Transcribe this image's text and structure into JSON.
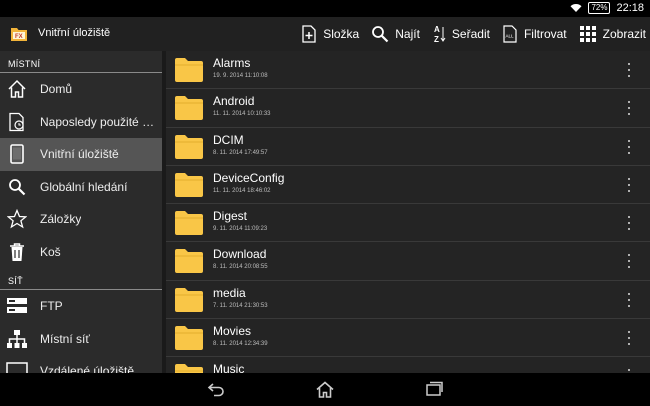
{
  "status": {
    "battery": "72%",
    "time": "22:18"
  },
  "app": {
    "title": "Vnitřní úložiště"
  },
  "actions": [
    {
      "label": "Složka",
      "icon": "new-folder-icon"
    },
    {
      "label": "Najít",
      "icon": "search-icon"
    },
    {
      "label": "Seřadit",
      "icon": "sort-az-icon"
    },
    {
      "label": "Filtrovat",
      "icon": "filter-icon"
    },
    {
      "label": "Zobrazit",
      "icon": "grid-view-icon"
    }
  ],
  "sidebar": {
    "sections": [
      {
        "header": "MÍSTNÍ",
        "items": [
          {
            "label": "Domů",
            "icon": "home-icon"
          },
          {
            "label": "Naposledy použité soubory",
            "icon": "recent-icon"
          },
          {
            "label": "Vnitřní úložiště",
            "icon": "tablet-icon",
            "active": true
          },
          {
            "label": "Globální hledání",
            "icon": "search-icon"
          },
          {
            "label": "Záložky",
            "icon": "star-icon"
          },
          {
            "label": "Koš",
            "icon": "trash-icon"
          }
        ]
      },
      {
        "header": "SÍŤ",
        "items": [
          {
            "label": "FTP",
            "icon": "server-icon"
          },
          {
            "label": "Místní síť",
            "icon": "network-icon"
          },
          {
            "label": "Vzdálené úložiště",
            "icon": "remote-storage-icon"
          }
        ]
      }
    ]
  },
  "files": [
    {
      "name": "Alarms",
      "date": "19. 9. 2014 11:10:08"
    },
    {
      "name": "Android",
      "date": "11. 11. 2014 10:10:33"
    },
    {
      "name": "DCIM",
      "date": "8. 11. 2014 17:49:57"
    },
    {
      "name": "DeviceConfig",
      "date": "11. 11. 2014 18:46:02"
    },
    {
      "name": "Digest",
      "date": "9. 11. 2014 11:09:23"
    },
    {
      "name": "Download",
      "date": "8. 11. 2014 20:08:55"
    },
    {
      "name": "media",
      "date": "7. 11. 2014 21:30:53"
    },
    {
      "name": "Movies",
      "date": "8. 11. 2014 12:34:39"
    },
    {
      "name": "Music",
      "date": ""
    }
  ],
  "colors": {
    "folder": "#f9c647",
    "active_item": "#555555"
  }
}
